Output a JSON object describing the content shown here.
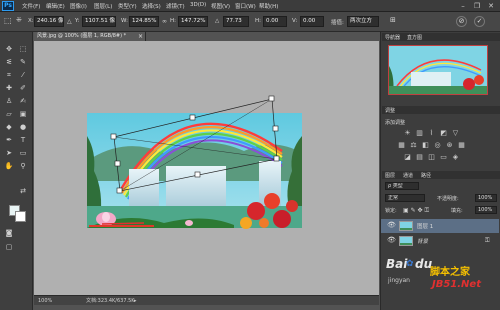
{
  "app": {
    "logo": "Ps",
    "menus": [
      "文件(F)",
      "编辑(E)",
      "图像(I)",
      "图层(L)",
      "类型(Y)",
      "选择(S)",
      "滤镜(T)",
      "3D(D)",
      "视图(V)",
      "窗口(W)",
      "帮助(H)"
    ],
    "window_buttons": [
      "–",
      "❐",
      "✕"
    ]
  },
  "options": {
    "x_label": "X:",
    "x_value": "240.16 像",
    "y_label": "Y:",
    "y_value": "1107.51 像",
    "w_label": "W:",
    "w_value": "124.85%",
    "h_label": "H:",
    "h_value": "147.72%",
    "angle_label": "△",
    "angle_value": "77.73",
    "h_skew_label": "H:",
    "h_skew_value": "0.00",
    "v_skew_label": "V:",
    "v_skew_value": "0.00",
    "interp_label": "插值:",
    "interp_value": "两次立方",
    "cancel_icon": "cancel-icon",
    "commit_icon": "commit-icon"
  },
  "document": {
    "tab_title": "风景.jpg @ 100% (图层 1, RGB/8#) *",
    "tab_close": "×",
    "zoom": "100%",
    "doc_info": "文档:323.4K/637.5K"
  },
  "panels": {
    "navigator_tabs": [
      "导航器",
      "直方图"
    ],
    "adjust_title": "调整",
    "adjust_subtitle": "添加调整",
    "layer_tabs": [
      "图层",
      "通道",
      "路径"
    ],
    "kind_label": "ρ 类型",
    "blend_mode": "正常",
    "opacity_label": "不透明度:",
    "opacity_value": "100%",
    "lock_label": "锁定:",
    "fill_label": "填充:",
    "fill_value": "100%",
    "layers": [
      {
        "name": "图层 1",
        "selected": true
      },
      {
        "name": "背景",
        "selected": false
      }
    ]
  },
  "watermark": {
    "brand": "Bai",
    "brand2": "du",
    "sub": "jingyan",
    "site_cn": "脚本之家",
    "site_en": "JB51.Net"
  }
}
